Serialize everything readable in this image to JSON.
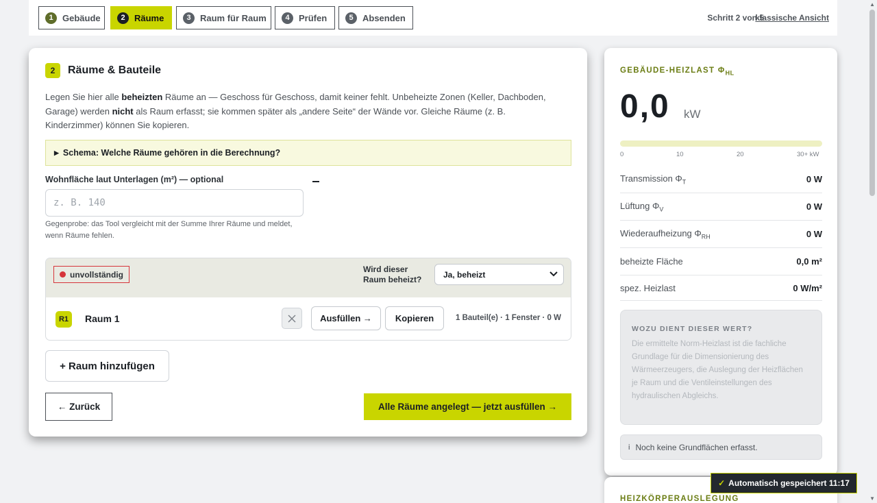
{
  "stepper": {
    "steps": [
      {
        "num": "1",
        "label": "Gebäude"
      },
      {
        "num": "2",
        "label": "Räume"
      },
      {
        "num": "3",
        "label": "Raum für Raum"
      },
      {
        "num": "4",
        "label": "Prüfen"
      },
      {
        "num": "5",
        "label": "Absenden"
      }
    ],
    "step_info": "Schritt 2 von 5",
    "classic_link": "klassische Ansicht"
  },
  "main": {
    "badge": "2",
    "title": "Räume & Bauteile",
    "intro_1": "Legen Sie hier alle ",
    "intro_bold_1": "beheizten",
    "intro_2": " Räume an — Geschoss für Geschoss, damit keiner fehlt. Unbeheizte Zonen (Keller, Dachboden, Garage) werden ",
    "intro_bold_2": "nicht",
    "intro_3": " als Raum erfasst; sie kommen später als „andere Seite“ der Wände vor. Gleiche Räume (z. B. Kinderzimmer) können Sie kopieren.",
    "schema_label": "Schema: Welche Räume gehören in die Berechnung?",
    "area_label": "Wohnfläche laut Unterlagen (m²) — optional",
    "area_placeholder": "z. B. 140",
    "area_value": "",
    "area_hint": "Gegenprobe: das Tool vergleicht mit der Summe Ihrer Räume und meldet, wenn Räume fehlen.",
    "room_status": "unvollständig",
    "heated_label": "Wird dieser Raum beheizt?",
    "heated_value": "Ja, beheizt",
    "room_tag": "R1",
    "room_name": "Raum 1",
    "fill_button": "Ausfüllen →",
    "copy_button": "Kopieren",
    "room_summary": "1 Bauteil(e) · 1 Fenster · 0 W",
    "add_room": "+ Raum hinzufügen",
    "back_button": "← Zurück",
    "next_button": "Alle Räume angelegt — jetzt ausfüllen →"
  },
  "side": {
    "title": "GEBÄUDE-HEIZLAST Φ",
    "title_sub": "HL",
    "value": "0,0",
    "unit": "kW",
    "scale_fraction": 0,
    "scale_ticks": [
      "0",
      "10",
      "20",
      "30+ kW"
    ],
    "rows": [
      {
        "label": "Transmission Φ",
        "sub": "T",
        "value": "0 W"
      },
      {
        "label": "Lüftung Φ",
        "sub": "V",
        "value": "0 W"
      },
      {
        "label": "Wiederaufheizung Φ",
        "sub": "RH",
        "value": "0 W"
      },
      {
        "label": "beheizte Fläche",
        "sub": "",
        "value": "0,0 m²"
      },
      {
        "label": "spez. Heizlast",
        "sub": "",
        "value": "0 W/m²"
      }
    ],
    "info_title": "WOZU DIENT DIESER WERT?",
    "info_text": "Die ermittelte Norm-Heizlast ist die fachliche Grundlage für die Dimensionierung des Wärmeerzeugers, die Auslegung der Heizflächen je Raum und die Ventileinstellungen des hydraulischen Abgleichs.",
    "note": "Noch keine Grundflächen erfasst.",
    "note_icon": "i"
  },
  "side2": {
    "title": "HEIZKÖRPERAUSLEGUNG"
  },
  "toast": {
    "check": "✓",
    "text": "Automatisch gespeichert 11:17"
  },
  "colors": {
    "accent": "#c9d500",
    "error": "#d6343a",
    "side_title": "#6b7d14"
  }
}
